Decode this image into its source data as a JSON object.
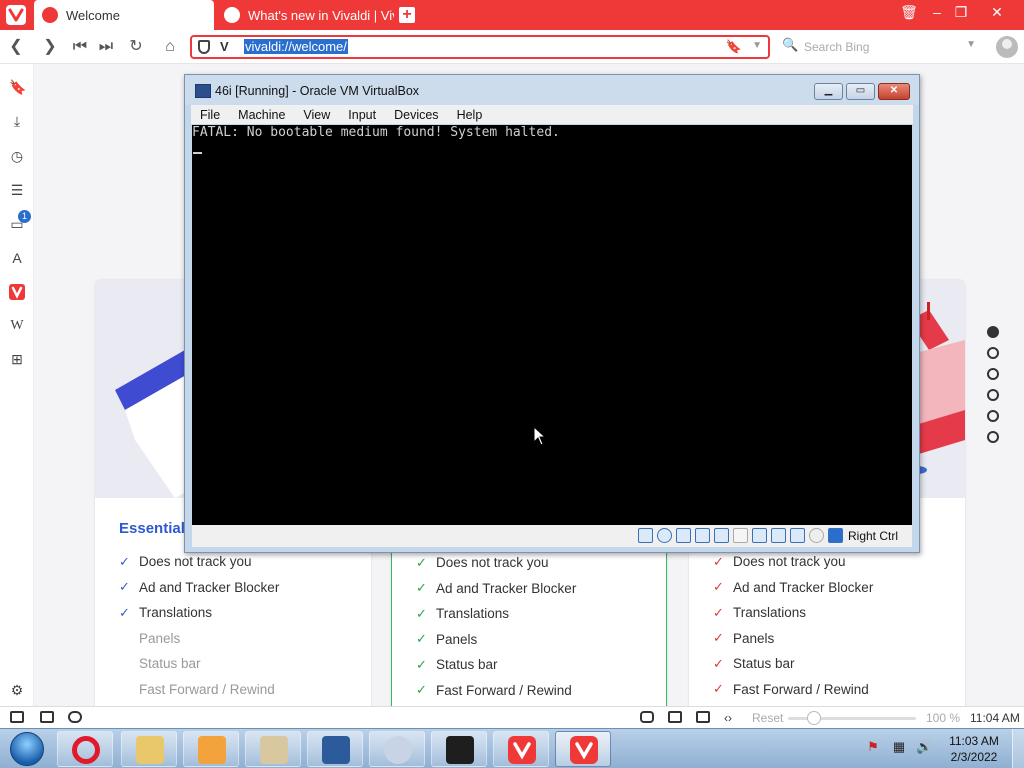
{
  "browser": {
    "tabs": [
      {
        "label": "Welcome",
        "active": true
      },
      {
        "label": "What's new in Vivaldi | Vival",
        "active": false
      }
    ],
    "address": {
      "url": "vivaldi://welcome/"
    },
    "search": {
      "placeholder": "Search Bing"
    },
    "sidebar": {
      "badge": "1"
    },
    "accent": "#ef3939"
  },
  "welcome": {
    "cards": [
      {
        "title": "Essential",
        "features": [
          {
            "label": "Does not track you",
            "enabled": true
          },
          {
            "label": "Ad and Tracker Blocker",
            "enabled": true
          },
          {
            "label": "Translations",
            "enabled": true
          },
          {
            "label": "Panels",
            "enabled": false
          },
          {
            "label": "Status bar",
            "enabled": false
          },
          {
            "label": "Fast Forward / Rewind",
            "enabled": false
          }
        ]
      },
      {
        "title": "",
        "features": [
          {
            "label": "Does not track you",
            "enabled": true
          },
          {
            "label": "Ad and Tracker Blocker",
            "enabled": true
          },
          {
            "label": "Translations",
            "enabled": true
          },
          {
            "label": "Panels",
            "enabled": true
          },
          {
            "label": "Status bar",
            "enabled": true
          },
          {
            "label": "Fast Forward / Rewind",
            "enabled": true
          }
        ]
      },
      {
        "title": "",
        "features": [
          {
            "label": "Does not track you",
            "enabled": true
          },
          {
            "label": "Ad and Tracker Blocker",
            "enabled": true
          },
          {
            "label": "Translations",
            "enabled": true
          },
          {
            "label": "Panels",
            "enabled": true
          },
          {
            "label": "Status bar",
            "enabled": true
          },
          {
            "label": "Fast Forward / Rewind",
            "enabled": true
          }
        ]
      }
    ],
    "pagination": {
      "count": 6,
      "current": 1
    }
  },
  "virtualbox": {
    "title": "46i [Running] - Oracle VM VirtualBox",
    "menu": [
      "File",
      "Machine",
      "View",
      "Input",
      "Devices",
      "Help"
    ],
    "console_text": "FATAL: No bootable medium found! System halted.",
    "host_key": "Right Ctrl"
  },
  "statusbar": {
    "reset_label": "Reset",
    "zoom": "100 %",
    "time": "11:04 AM"
  },
  "taskbar": {
    "time": "11:03 AM",
    "date": "2/3/2022"
  }
}
